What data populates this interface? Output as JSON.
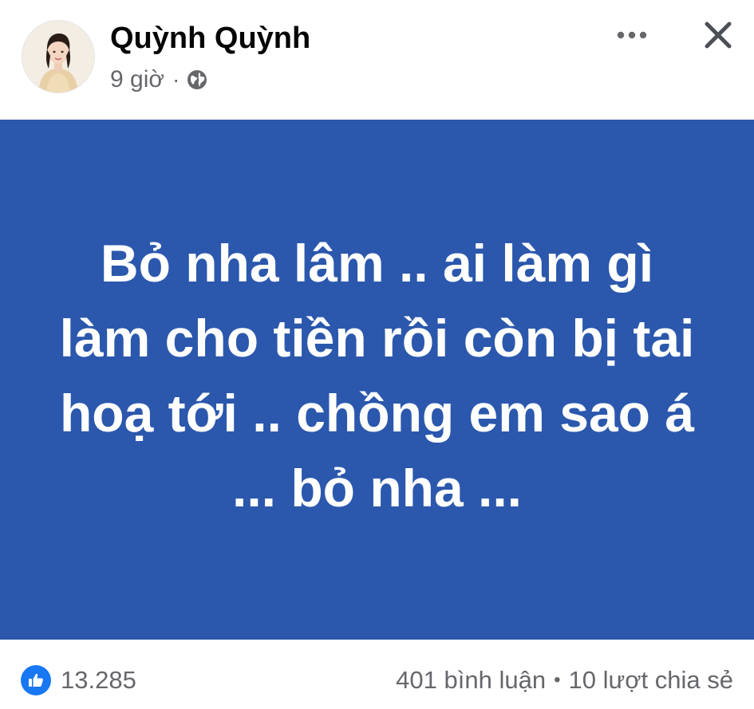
{
  "post": {
    "author": {
      "name": "Quỳnh Quỳnh",
      "avatar_icon": "profile-photo"
    },
    "meta": {
      "time": "9 giờ",
      "separator": "·",
      "audience_icon": "globe-icon"
    },
    "actions": {
      "more_icon": "more-options-icon",
      "close_icon": "close-icon"
    },
    "status": {
      "text": "Bỏ nha lâm .. ai làm gì làm cho tiền rồi còn bị tai hoạ tới .. chồng em sao á ... bỏ nha ...",
      "background_color": "#2b58ad",
      "text_color": "#ffffff"
    },
    "footer": {
      "reaction_icon": "like-icon",
      "reaction_count": "13.285",
      "comments": "401 bình luận",
      "separator": "•",
      "shares": "10 lượt chia sẻ"
    }
  }
}
